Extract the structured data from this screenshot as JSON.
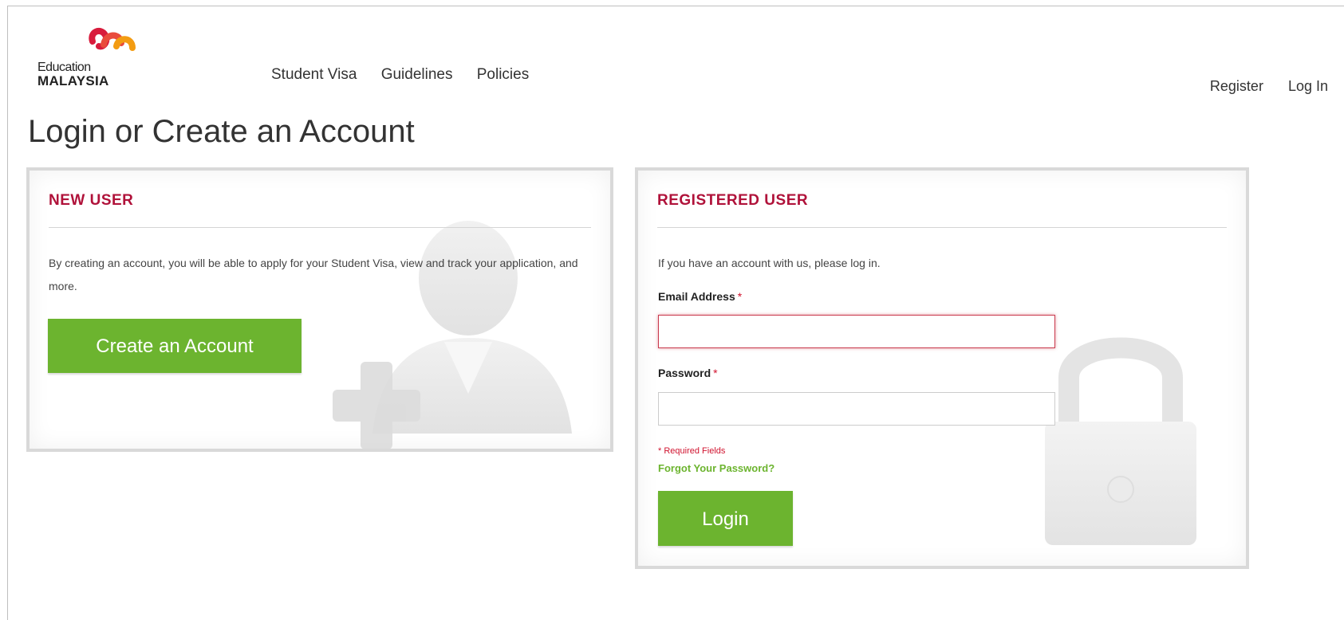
{
  "header": {
    "logo": {
      "line1": "Education",
      "line2": "MALAYSIA"
    },
    "nav": [
      "Student Visa",
      "Guidelines",
      "Policies"
    ],
    "register_link": "Register",
    "login_link": "Log In"
  },
  "page_title": "Login or Create an Account",
  "new_user": {
    "heading": "NEW USER",
    "description": "By creating an account, you will be able to apply for your Student Visa, view and track your application, and more.",
    "create_button": "Create an Account"
  },
  "registered_user": {
    "heading": "REGISTERED USER",
    "intro": "If you have an account with us, please log in.",
    "email_label": "Email Address",
    "email_value": "",
    "password_label": "Password",
    "password_value": "",
    "required_mark": "*",
    "required_note": "* Required Fields",
    "forgot_link": "Forgot Your Password?",
    "login_button": "Login"
  },
  "colors": {
    "accent_red": "#b0123a",
    "brand_green": "#6cb42f",
    "panel_border": "#d9d9d9"
  },
  "icons": [
    "logo-swirl-icon",
    "user-add-icon",
    "padlock-icon"
  ]
}
